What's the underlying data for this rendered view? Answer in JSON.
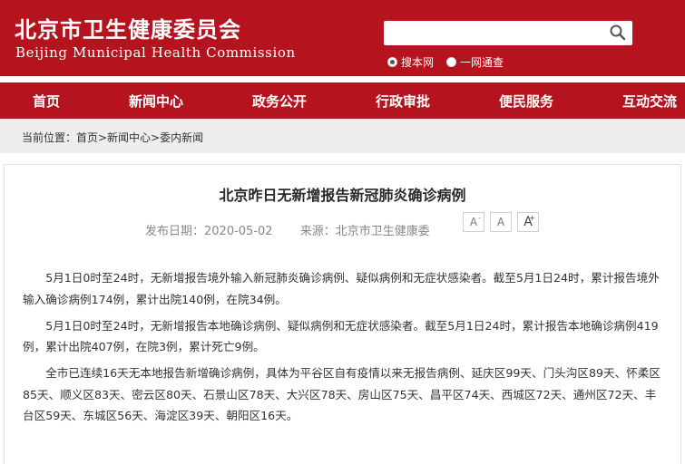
{
  "header": {
    "logo_cn": "北京市卫生健康委员会",
    "logo_en": "Beijing Municipal Health Commission",
    "search_placeholder": "",
    "radio_options": [
      {
        "label": "搜本网",
        "checked": true
      },
      {
        "label": "一网通查",
        "checked": false
      }
    ],
    "brand_color": "#b5141f"
  },
  "nav": {
    "items": [
      {
        "label": "首页"
      },
      {
        "label": "新闻中心"
      },
      {
        "label": "政务公开"
      },
      {
        "label": "行政审批"
      },
      {
        "label": "便民服务"
      },
      {
        "label": "互动交流"
      }
    ]
  },
  "breadcrumb": {
    "text": "当前位置：首页>新闻中心>委内新闻"
  },
  "article": {
    "title": "北京昨日无新增报告新冠肺炎确诊病例",
    "date": "发布日期：2020-05-02",
    "source": "来源：北京市卫生健康委",
    "font_buttons": [
      "A",
      "A",
      "A"
    ],
    "paragraphs": [
      "5月1日0时至24时，无新增报告境外输入新冠肺炎确诊病例、疑似病例和无症状感染者。截至5月1日24时，累计报告境外输入确诊病例174例，累计出院140例，在院34例。",
      "5月1日0时至24时，无新增报告本地确诊病例、疑似病例和无症状感染者。截至5月1日24时，累计报告本地确诊病例419例，累计出院407例，在院3例，累计死亡9例。",
      "全市已连续16天无本地报告新增确诊病例，具体为平谷区自有疫情以来无报告病例、延庆区99天、门头沟区89天、怀柔区85天、顺义区83天、密云区80天、石景山区78天、大兴区78天、房山区75天、昌平区74天、西城区72天、通州区72天、丰台区59天、东城区56天、海淀区39天、朝阳区16天。"
    ]
  }
}
